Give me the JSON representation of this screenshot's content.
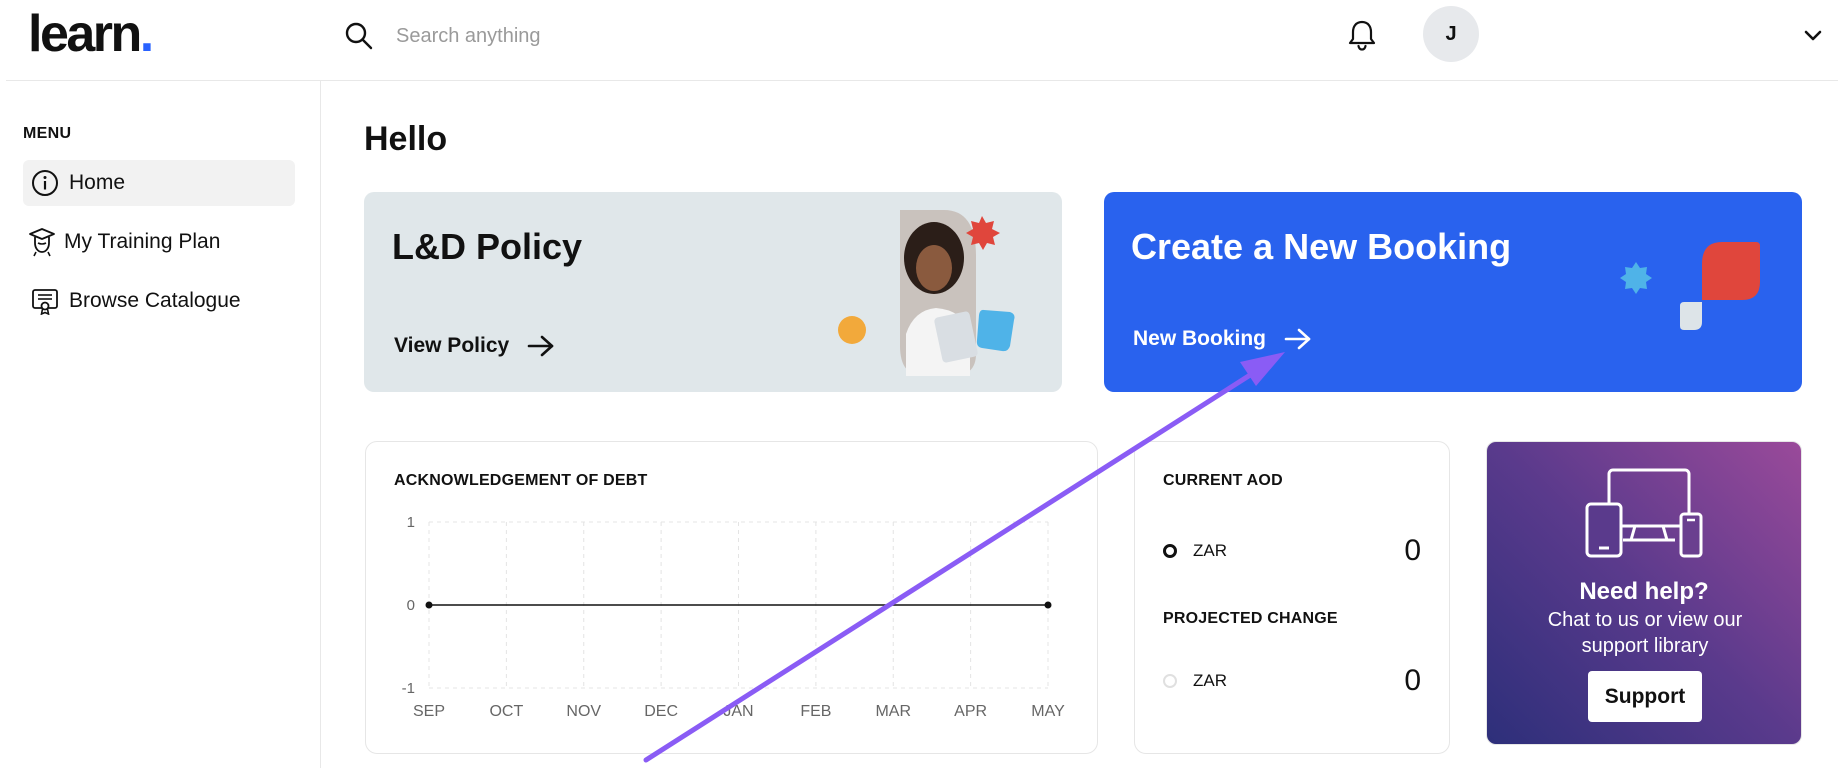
{
  "header": {
    "logo_text": "learn",
    "logo_dot": ".",
    "search_placeholder": "Search anything",
    "avatar_initial": "J"
  },
  "sidebar": {
    "menu_title": "MENU",
    "items": [
      {
        "label": "Home",
        "icon": "info-icon",
        "active": true
      },
      {
        "label": "My Training Plan",
        "icon": "graduate-icon",
        "active": false
      },
      {
        "label": "Browse Catalogue",
        "icon": "certificate-icon",
        "active": false
      }
    ]
  },
  "main": {
    "greeting": "Hello",
    "policy_card": {
      "title": "L&D Policy",
      "link_label": "View Policy"
    },
    "booking_card": {
      "title": "Create a New Booking",
      "link_label": "New Booking"
    },
    "aod_chart": {
      "title": "ACKNOWLEDGEMENT OF DEBT"
    },
    "current_aod": {
      "title": "CURRENT AOD",
      "currency": "ZAR",
      "value": "0",
      "projected_title": "PROJECTED CHANGE",
      "projected_currency": "ZAR",
      "projected_value": "0"
    },
    "help_card": {
      "title": "Need help?",
      "text": "Chat to us or view our support library",
      "button_label": "Support"
    }
  },
  "colors": {
    "accent": "#2962ee",
    "policy_bg": "#e0e7ea",
    "annotation_arrow": "#8a5cf5"
  },
  "chart_data": {
    "type": "line",
    "categories": [
      "SEP",
      "OCT",
      "NOV",
      "DEC",
      "JAN",
      "FEB",
      "MAR",
      "APR",
      "MAY"
    ],
    "series": [
      {
        "values": [
          0,
          null,
          null,
          null,
          null,
          null,
          null,
          null,
          0
        ]
      }
    ],
    "yticks": [
      "1",
      "0",
      "-1"
    ],
    "ylim": [
      -1,
      1
    ],
    "grid": true,
    "title": "ACKNOWLEDGEMENT OF DEBT"
  }
}
